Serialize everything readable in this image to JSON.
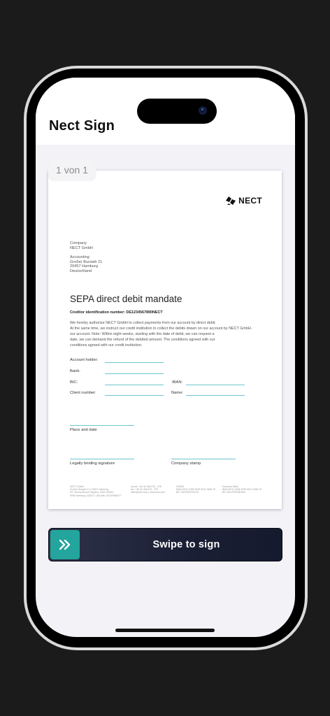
{
  "app": {
    "title": "Nect Sign"
  },
  "document": {
    "page_indicator": "1 von 1",
    "logo_text": "NECT",
    "company_block": [
      "Company",
      "NECT GmbH"
    ],
    "department_block": [
      "Accounting",
      "Großer Burstah 21",
      "20457 Hamburg",
      "Deutschland"
    ],
    "title": "SEPA direct debit mandate",
    "creditor_id": "Creditor identification number: DE1234567890NECT",
    "body_lines": [
      "We hereby authorize NECT GmbH to collect payments from our account by direct debit.",
      "At the same time, we instruct our credit institution to collect the debits drawn on our account by NECT GmbH.",
      "our account. Note: Within eight weeks, starting with the date of debit, we can request a",
      "date, we can demand the refund of the debited amount. The conditions agreed with our",
      "conditions agreed with our credit institution."
    ],
    "fields": {
      "account_holder": "Account holder:",
      "bank": "Bank:",
      "bic": "BIC:",
      "iban": "IBAN:",
      "client_number": "Client number:",
      "name": "Name:"
    },
    "signatures": {
      "place_and_date": "Place and date",
      "legally_binding": "Legally binding signature",
      "company_stamp": "Company stamp"
    },
    "footer": [
      [
        "NECT GmbH",
        "Großer Burstah 21 | 20457 Hamburg",
        "GF: Benny Bennet Jürgens, Carlo Ulbrich",
        "HRB Hamburg 143327 | USt-IdNr. DE319565077"
      ],
      [
        "phone: +49 40 466 678 - 978",
        "fax:      +49 40 466 678 - 979",
        "hello@nect.com | www.nect.com"
      ],
      [
        "HASPA",
        "IBAN DE12 3456 5678 9012 3456 78",
        "BIC HASPDEHHXXX"
      ],
      [
        "Deutsche Bank",
        "IBAN DE12 3456 5678 9012 3456 78",
        "BIC DEUTDEDBHAM"
      ]
    ]
  },
  "swipe": {
    "label": "Swipe to sign",
    "icon": "chevron-double-right-icon"
  },
  "colors": {
    "accent": "#23a59d",
    "swipe_bg": "#1b1f35",
    "field_line": "#6bc6cf"
  }
}
